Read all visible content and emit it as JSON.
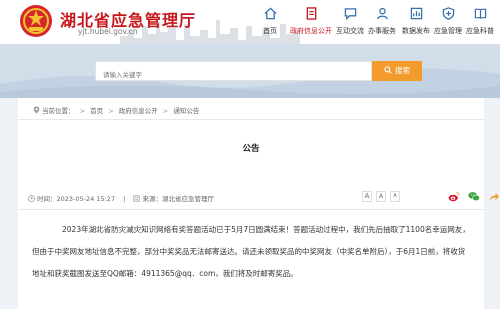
{
  "header": {
    "title": "湖北省应急管理厅",
    "url": "yjt.hubei.gov.cn",
    "nav": [
      {
        "label": "首页",
        "icon": "home-icon"
      },
      {
        "label": "政府信息公开",
        "icon": "document-icon"
      },
      {
        "label": "互动交流",
        "icon": "chat-icon"
      },
      {
        "label": "办事服务",
        "icon": "person-service-icon"
      },
      {
        "label": "数据发布",
        "icon": "data-icon"
      },
      {
        "label": "应急管理",
        "icon": "emergency-icon"
      },
      {
        "label": "应急科普",
        "icon": "book-icon"
      }
    ],
    "active_nav": "政府信息公开",
    "brand_color": "#c8161d"
  },
  "search": {
    "placeholder": "请输入关键字",
    "button_label": "搜索",
    "button_color": "#f39c2d"
  },
  "breadcrumb": {
    "prefix": "当前位置：",
    "items": [
      "首页",
      "政府信息公开",
      "通知公告"
    ]
  },
  "article": {
    "title": "公告",
    "time_label": "时间：",
    "time": "2023-05-24 15:27",
    "source_label": "来源：",
    "source": "湖北省应急管理厅",
    "font_sizes": [
      "A",
      "A",
      "A"
    ],
    "body": "2023年湖北省防灾减灾知识网络有奖答题活动已于5月7日圆满结束！答题活动过程中，我们先后抽取了1100名幸运网友，但由于中奖网友地址信息不完整，部分中奖奖品无法邮寄送达。请还未领取奖品的中奖网友（中奖名单附后），于6月1日前，将收货地址和获奖截图发送至QQ邮箱：4911365@qq．com，我们将及时邮寄奖品。"
  }
}
